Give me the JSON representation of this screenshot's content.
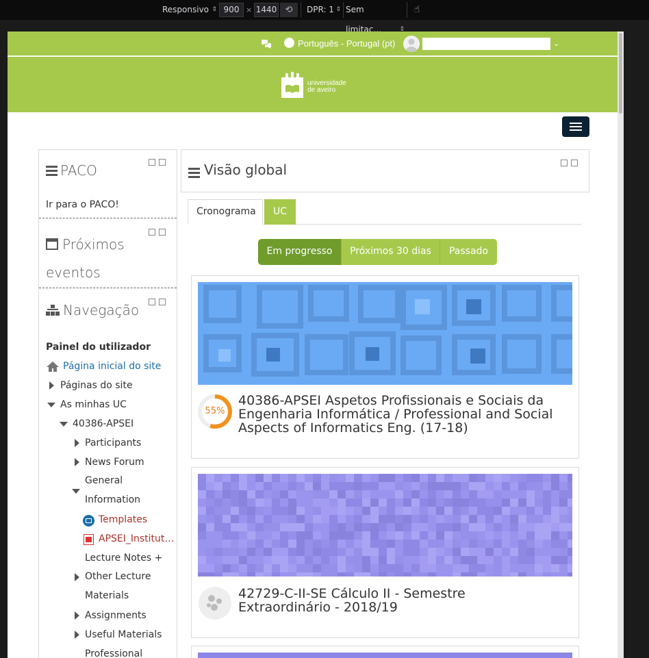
{
  "devtools": {
    "device": "Responsivo",
    "width": "900",
    "times": "×",
    "height": "1440",
    "dpr": "DPR: 1",
    "throttle": "Sem limitaç…"
  },
  "topnav": {
    "language": "Português - Portugal (pt)"
  },
  "logo": {
    "line1": "universidade",
    "line2": "de aveiro"
  },
  "blocks": {
    "paco": {
      "title": "PACO",
      "link": "Ir para o PACO!"
    },
    "events": {
      "title_line1": "Próximos",
      "title_line2": "eventos"
    },
    "nav": {
      "title": "Navegação"
    }
  },
  "navigation": {
    "dashboard": "Painel do utilizador",
    "site_home": "Página inicial do site",
    "site_pages": "Páginas do site",
    "my_courses": "As minhas UC",
    "course": "40386-APSEI",
    "participants": "Participants",
    "news": "News Forum",
    "general_l1": "General",
    "general_l2": "Information",
    "templates": "Templates",
    "pdf": "APSEI_Institut…",
    "lecture_notes": "Lecture Notes +",
    "other_l1": "Other Lecture",
    "other_l2": "Materials",
    "assignments": "Assignments",
    "useful": "Useful Materials",
    "professional": "Professional"
  },
  "main": {
    "title": "Visão global",
    "tabs": [
      {
        "label": "Cronograma"
      },
      {
        "label": "UC"
      }
    ],
    "filters": [
      {
        "label": "Em progresso"
      },
      {
        "label": "Próximos 30 dias"
      },
      {
        "label": "Passado"
      }
    ]
  },
  "courses": [
    {
      "name": "40386-APSEI Aspetos Profissionais e Sociais da Engenharia Informática / Professional and Social Aspects of Informatics Eng. (17-18)",
      "progress_label": "55%",
      "progress": 0.55
    },
    {
      "name": "42729-C-II-SE Cálculo II - Semestre Extraordinário - 2018/19"
    }
  ],
  "colors": {
    "brand_green": "#a6c94c",
    "active_green": "#6f9c2b",
    "link_blue": "#1a6fa8",
    "card1_bg": "#6aaaf5",
    "card2_bg": "#9b94ee",
    "progress_orange": "#f0931e"
  }
}
